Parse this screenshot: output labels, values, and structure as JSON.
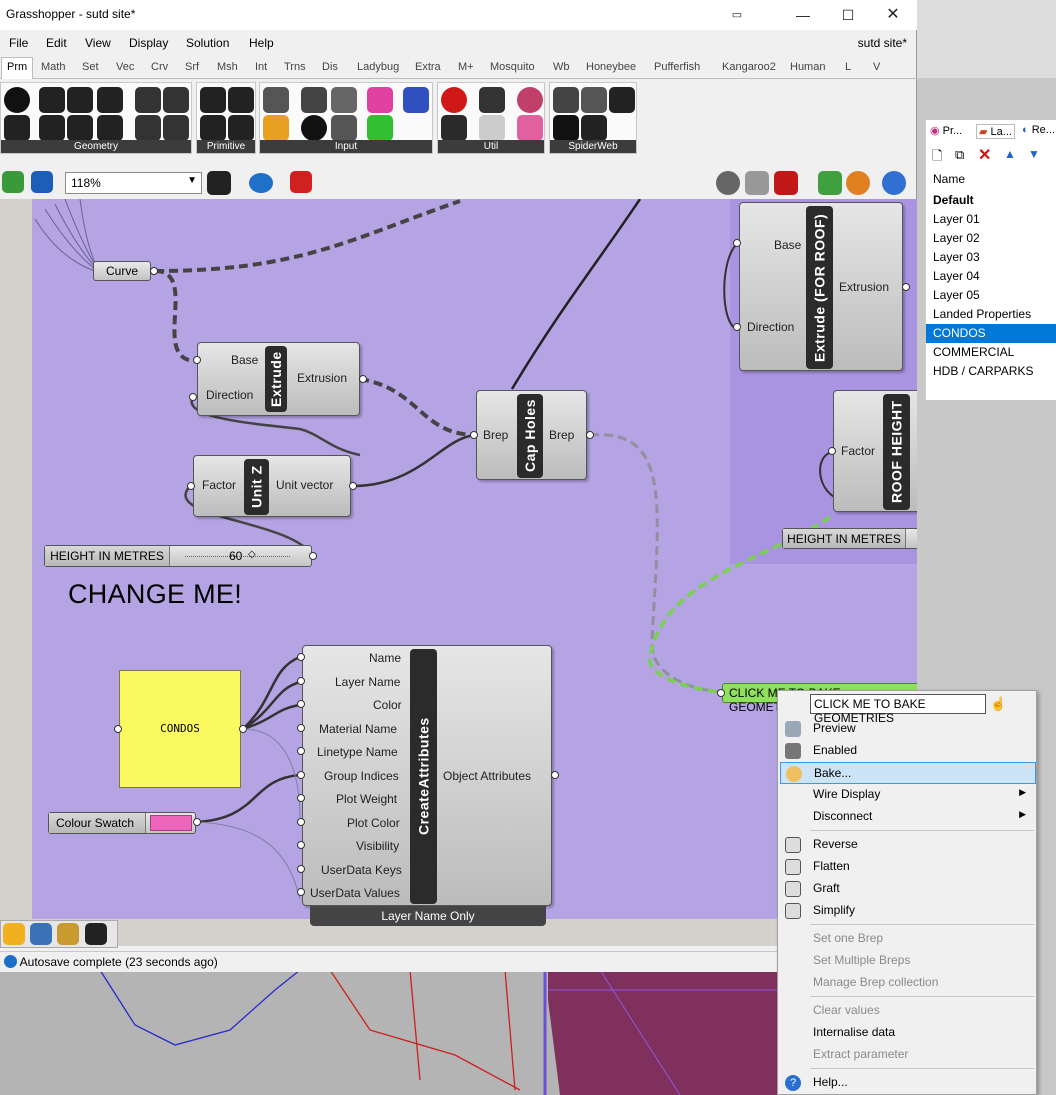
{
  "window": {
    "title": "Grasshopper - sutd site*",
    "doc_name": "sutd site*",
    "min_icon": "minimize-icon",
    "max_icon": "maximize-icon",
    "close_icon": "close-icon"
  },
  "menubar": [
    "File",
    "Edit",
    "View",
    "Display",
    "Solution",
    "Help"
  ],
  "tabs": [
    "Prm",
    "Math",
    "Set",
    "Vec",
    "Crv",
    "Srf",
    "Msh",
    "Int",
    "Trns",
    "Dis",
    "Ladybug",
    "Extra",
    "M+",
    "Mosquito",
    "Wb",
    "Honeybee",
    "Pufferfish",
    "Kangaroo2",
    "Human",
    "L",
    "V"
  ],
  "ribbon_groups": [
    "Geometry",
    "Primitive",
    "Input",
    "Util",
    "SpiderWeb"
  ],
  "zoom": "118%",
  "canvas": {
    "curve_label": "Curve",
    "extrude": {
      "title": "Extrude",
      "in1": "Base",
      "in2": "Direction",
      "out": "Extrusion"
    },
    "unitz": {
      "title": "Unit Z",
      "in": "Factor",
      "out": "Unit vector"
    },
    "capholes": {
      "title": "Cap Holes",
      "in": "Brep",
      "out": "Brep"
    },
    "extrude_roof": {
      "title": "Extrude (FOR ROOF)",
      "in1": "Base",
      "in2": "Direction",
      "out": "Extrusion"
    },
    "roof_height": {
      "title": "ROOF HEIGHT",
      "in": "Factor"
    },
    "slider_label": "HEIGHT IN METRES",
    "slider_value": "60",
    "slider2_label": "HEIGHT IN METRES",
    "change_me": "CHANGE ME!",
    "panel_text": "CONDOS",
    "colour_swatch": "Colour Swatch",
    "swatch_color": "#ee66bb",
    "create_attr": {
      "title": "CreateAttributes",
      "inputs": [
        "Name",
        "Layer Name",
        "Color",
        "Material Name",
        "Linetype Name",
        "Group Indices",
        "Plot Weight",
        "Plot Color",
        "Visibility",
        "UserData Keys",
        "UserData Values"
      ],
      "output": "Object Attributes",
      "footer": "Layer Name Only"
    },
    "bake_button": "CLICK ME TO BAKE GEOMETRIES"
  },
  "status": "Autosave complete (23 seconds ago)",
  "layers_panel": {
    "tabs": [
      "Pr...",
      "La...",
      "Re..."
    ],
    "header": "Name",
    "items": [
      "Default",
      "Layer 01",
      "Layer 02",
      "Layer 03",
      "Layer 04",
      "Layer 05",
      "Landed Properties",
      "CONDOS",
      "COMMERCIAL",
      "HDB / CARPARKS"
    ],
    "selected": "CONDOS"
  },
  "context_menu": {
    "name_field": "CLICK ME TO BAKE GEOMETRIES",
    "items": [
      {
        "label": "Preview",
        "icon": "preview-icon"
      },
      {
        "label": "Enabled",
        "icon": "enabled-icon"
      },
      {
        "label": "Bake...",
        "icon": "bake-icon"
      },
      {
        "label": "Wire Display",
        "icon": ""
      },
      {
        "label": "Disconnect",
        "icon": ""
      },
      {
        "label": "Reverse",
        "icon": "reverse-icon"
      },
      {
        "label": "Flatten",
        "icon": "flatten-icon"
      },
      {
        "label": "Graft",
        "icon": "graft-icon"
      },
      {
        "label": "Simplify",
        "icon": "simplify-icon"
      },
      {
        "label": "Set one Brep",
        "icon": ""
      },
      {
        "label": "Set Multiple Breps",
        "icon": ""
      },
      {
        "label": "Manage Brep collection",
        "icon": ""
      },
      {
        "label": "Clear values",
        "icon": ""
      },
      {
        "label": "Internalise data",
        "icon": ""
      },
      {
        "label": "Extract parameter",
        "icon": ""
      },
      {
        "label": "Help...",
        "icon": "help-icon"
      }
    ],
    "highlighted": "Bake..."
  },
  "colors": {
    "canvas": "#b4a4e4",
    "selection": "#0078d7",
    "bake_button": "#8fe05c",
    "panel_yellow": "#fafa60"
  }
}
